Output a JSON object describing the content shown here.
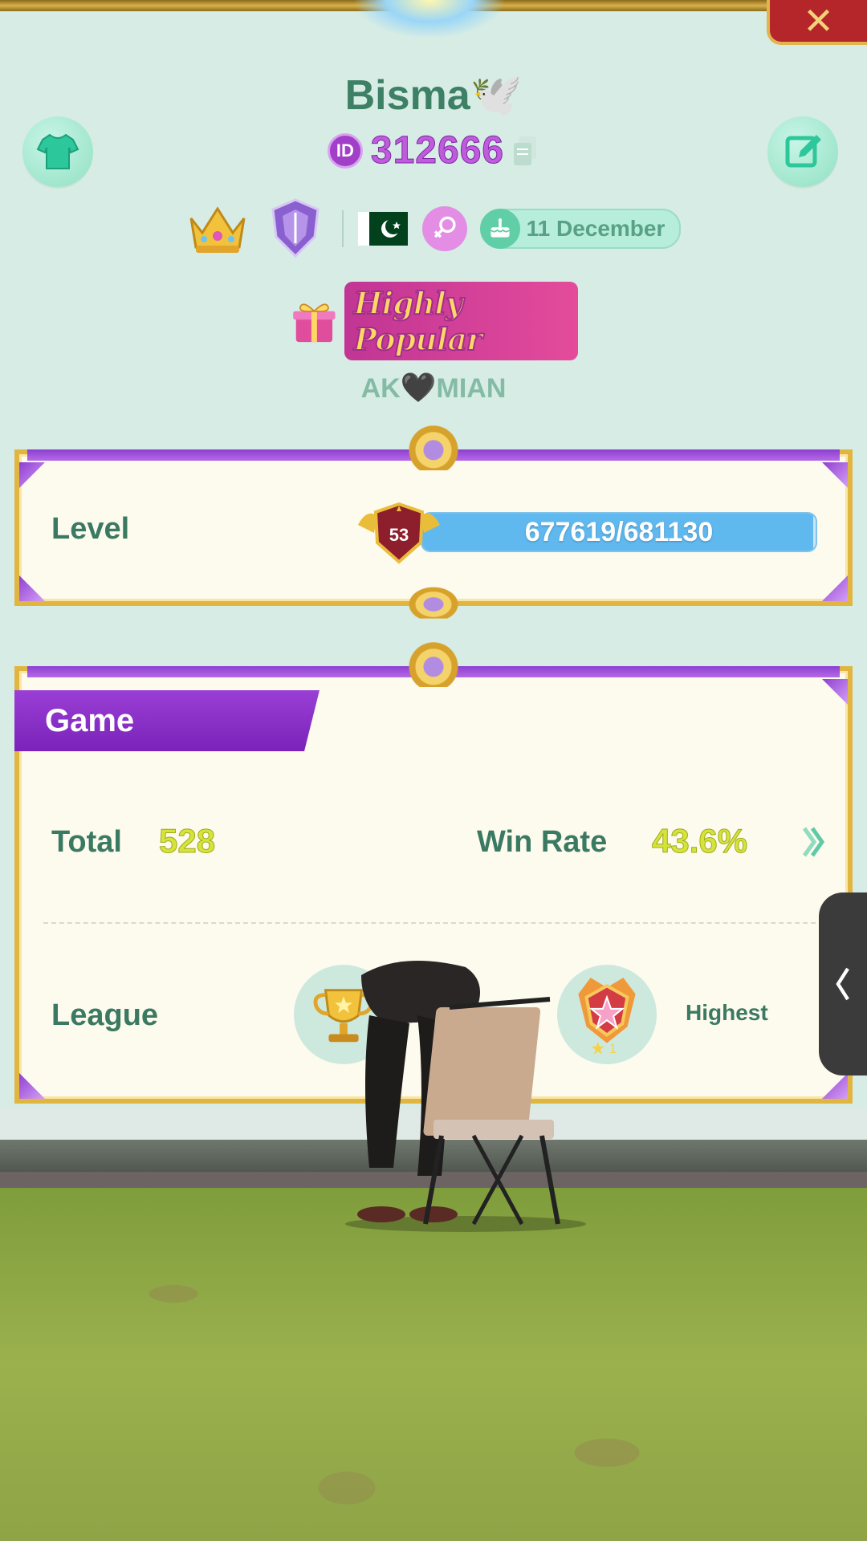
{
  "header": {
    "close_label": "✕"
  },
  "profile": {
    "name": "Bisma🕊️",
    "id_badge": "ID",
    "id_number": "312666",
    "birthday": "11 December",
    "country_flag": "Pakistan",
    "popularity_label": "Highly Popular",
    "family_tag_left": "AK",
    "family_tag_heart": "🖤",
    "family_tag_right": "MIAN"
  },
  "level": {
    "label": "Level",
    "value": "53",
    "progress_text": "677619/681130",
    "progress_fraction": 0.9948
  },
  "game": {
    "tab_label": "Game",
    "total_label": "Total",
    "total_value": "528",
    "win_rate_label": "Win Rate",
    "win_rate_value": "43.6%",
    "league_label": "League",
    "highest_label": "Highest",
    "highest_star_count": "1"
  },
  "colors": {
    "accent_green": "#3b7a62",
    "accent_purple": "#9a3fd5",
    "gold": "#e0b640",
    "bar_blue": "#5fb8ee"
  },
  "icons": [
    "shirt-icon",
    "edit-icon",
    "copy-icon",
    "crown-icon",
    "shield-icon",
    "flag-icon",
    "female-icon",
    "cake-icon",
    "gift-icon",
    "trophy-icon",
    "chevron-right-icon",
    "chevron-left-icon"
  ]
}
